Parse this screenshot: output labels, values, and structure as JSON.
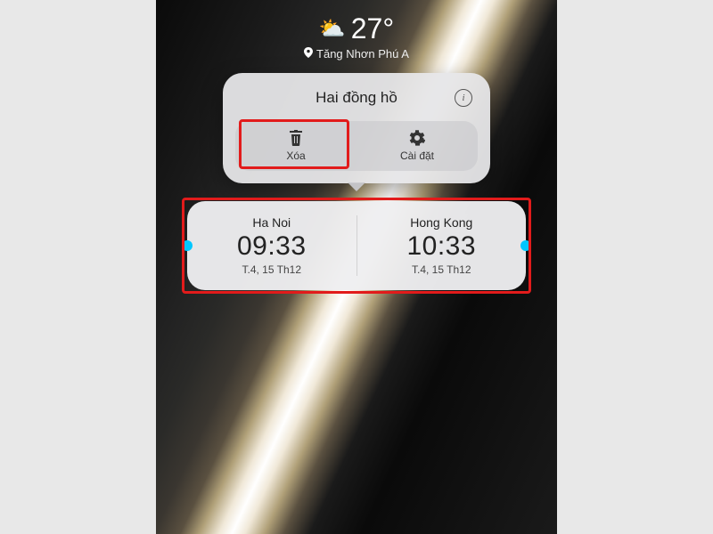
{
  "weather": {
    "temperature": "27°",
    "location": "Tăng Nhơn Phú A"
  },
  "popup": {
    "title": "Hai đồng hồ",
    "info_label": "i",
    "actions": {
      "delete": "Xóa",
      "settings": "Cài đặt"
    }
  },
  "widget": {
    "clocks": [
      {
        "city": "Ha Noi",
        "time": "09:33",
        "date": "T.4, 15 Th12"
      },
      {
        "city": "Hong Kong",
        "time": "10:33",
        "date": "T.4, 15 Th12"
      }
    ]
  }
}
